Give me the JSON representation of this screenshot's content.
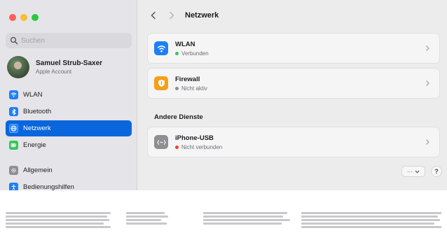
{
  "colors": {
    "accent": "#0a66dc",
    "wifi_icon": "#1f7ff5",
    "firewall_icon": "#f4a018",
    "usb_icon": "#8e8e93",
    "status_green": "#34c759",
    "status_gray": "#8e8e93",
    "status_red": "#ff3b30"
  },
  "search": {
    "placeholder": "Suchen"
  },
  "account": {
    "name": "Samuel Strub-Saxer",
    "subtitle": "Apple Account"
  },
  "sidebar": {
    "items": [
      {
        "label": "WLAN",
        "icon": "wifi-icon",
        "active": false
      },
      {
        "label": "Bluetooth",
        "icon": "bluetooth-icon",
        "active": false
      },
      {
        "label": "Netzwerk",
        "icon": "globe-icon",
        "active": true
      },
      {
        "label": "Energie",
        "icon": "battery-icon",
        "active": false
      },
      {
        "label": "Allgemein",
        "icon": "gear-icon",
        "active": false
      },
      {
        "label": "Bedienungshilfen",
        "icon": "accessibility-icon",
        "active": false
      }
    ]
  },
  "main": {
    "title": "Netzwerk",
    "services": [
      {
        "title": "WLAN",
        "status": "Verbunden",
        "status_color": "green",
        "icon": "wifi-icon"
      },
      {
        "title": "Firewall",
        "status": "Nicht aktiv",
        "status_color": "gray",
        "icon": "shield-icon"
      }
    ],
    "other_section_label": "Andere Dienste",
    "other_services": [
      {
        "title": "iPhone-USB",
        "status": "Nicht verbunden",
        "status_color": "red",
        "icon": "usb-icon"
      }
    ],
    "more_button_label": "···",
    "help_button_label": "?"
  }
}
